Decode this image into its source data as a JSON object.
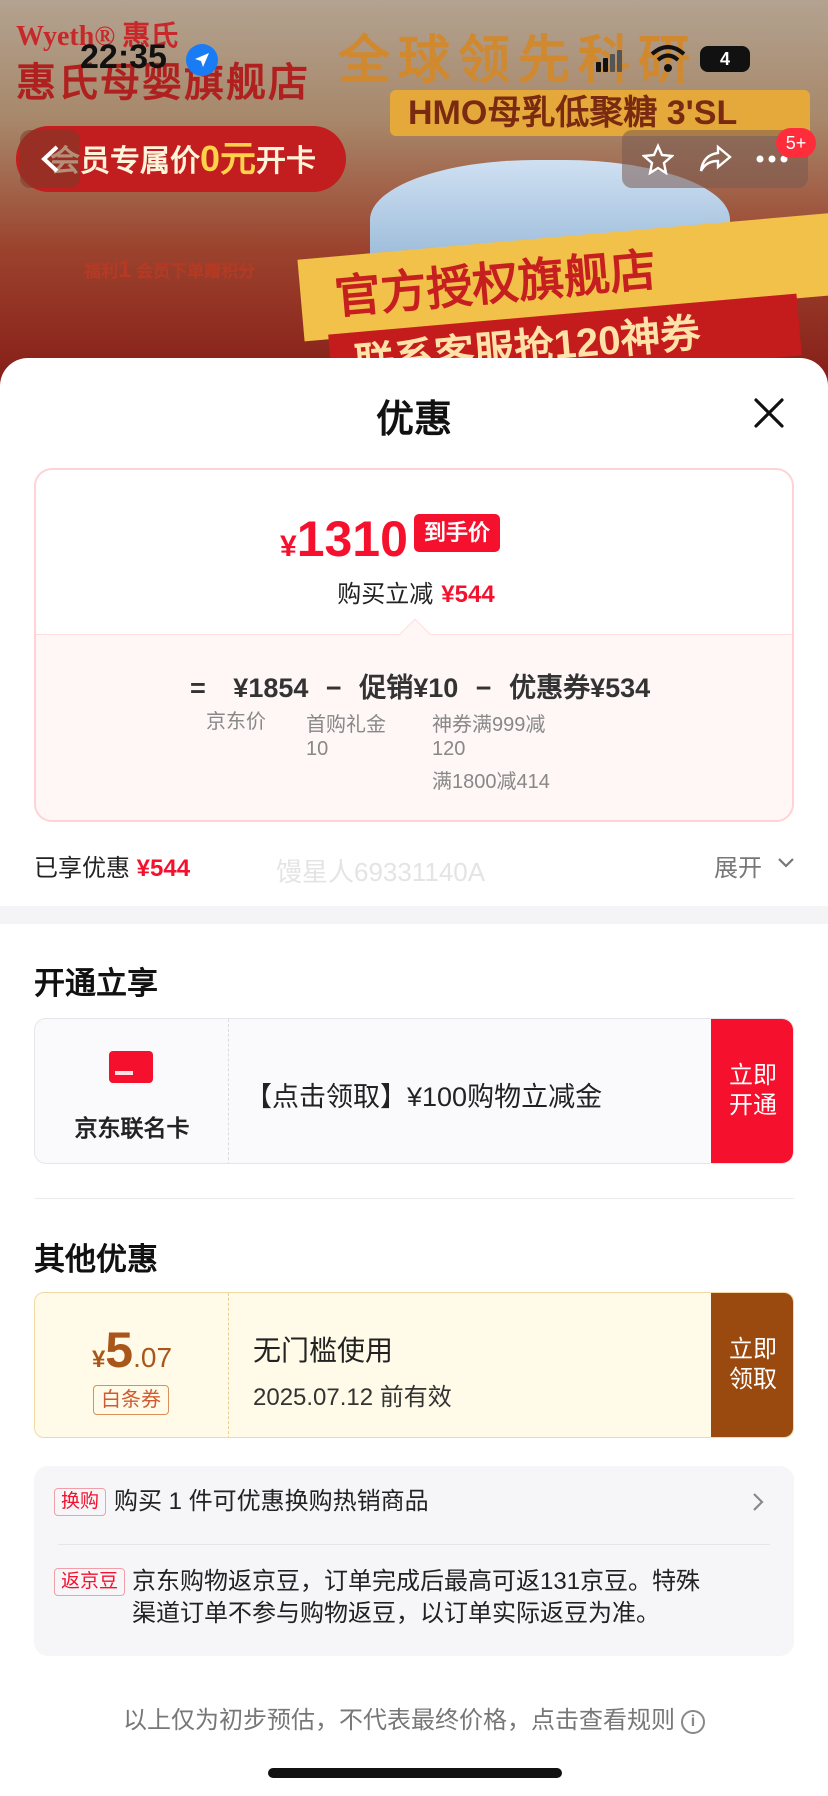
{
  "status_bar": {
    "time": "22:35",
    "battery": "4"
  },
  "banner": {
    "brand": "Wyeth® 惠氏",
    "shop": "惠氏母婴旗舰店",
    "headline": "全球领先科研",
    "hmo": "HMO母乳低聚糖 3'SL",
    "member_prefix": "会员专属价",
    "member_zero": "0元",
    "member_suffix": "开卡",
    "benefit_prefix": "福利",
    "benefit_num": "1",
    "benefit_text": "会员下单赠积分",
    "auth": "官方授权旗舰店",
    "coupon": "联系客服抢120神券"
  },
  "nav": {
    "badge": "5+"
  },
  "sheet": {
    "title": "优惠",
    "price_card": {
      "currency": "¥",
      "final_price": "1310",
      "final_tag": "到手价",
      "save_label": "购买立减",
      "save_amount": "¥544",
      "eq_sign": "=",
      "jd_price": "¥1854",
      "jd_price_label": "京东价",
      "minus1": "−",
      "promo": "促销¥10",
      "promo_sub1": "首购礼金",
      "promo_sub2": "10",
      "minus2": "−",
      "coupon": "优惠券¥534",
      "coupon_sub1": "神券满999减",
      "coupon_sub2": "120",
      "coupon_sub3": "满1800减414"
    },
    "enjoyed_label": "已享优惠",
    "enjoyed_amount": "¥544",
    "watermark": "馒星人69331140A",
    "expand_label": "展开"
  },
  "open_section": {
    "title": "开通立享",
    "card_name": "京东联名卡",
    "card_desc": "【点击领取】¥100购物立减金",
    "btn_line1": "立即",
    "btn_line2": "开通"
  },
  "other_section": {
    "title": "其他优惠",
    "coupon_currency": "¥",
    "coupon_int": "5",
    "coupon_dec": ".07",
    "coupon_type": "白条券",
    "coupon_title": "无门槛使用",
    "coupon_expiry": "2025.07.12 前有效",
    "btn_line1": "立即",
    "btn_line2": "领取"
  },
  "info": {
    "tag1": "换购",
    "text1": "购买 1 件可优惠换购热销商品",
    "tag2": "返京豆",
    "text2_line1": "京东购物返京豆，订单完成后最高可返131京豆。特殊",
    "text2_line2": "渠道订单不参与购物返豆，以订单实际返豆为准。"
  },
  "footer": {
    "note": "以上仅为初步预估，不代表最终价格，点击查看规则",
    "info_icon": "i"
  },
  "colors": {
    "accent_red": "#f5112d",
    "coupon_brown": "#9a4a0f"
  }
}
